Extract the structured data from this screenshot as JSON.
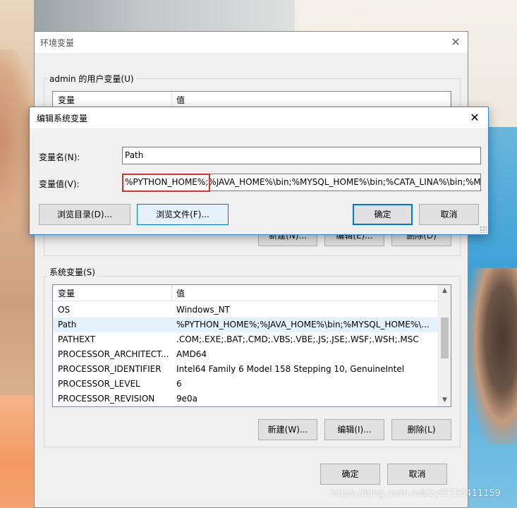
{
  "env_dialog": {
    "title": "环境变量",
    "user_group_label": "admin 的用户变量(U)",
    "user_list": {
      "col_var": "变量",
      "col_val": "值"
    },
    "user_buttons": {
      "new": "新建(N)...",
      "edit": "编辑(E)...",
      "delete": "删除(D)"
    },
    "system_group_label": "系统变量(S)",
    "system_list": {
      "col_var": "变量",
      "col_val": "值",
      "rows": [
        {
          "name": "OS",
          "value": "Windows_NT"
        },
        {
          "name": "Path",
          "value": "%PYTHON_HOME%;%JAVA_HOME%\\bin;%MYSQL_HOME%\\..."
        },
        {
          "name": "PATHEXT",
          "value": ".COM;.EXE;.BAT;.CMD;.VBS;.VBE;.JS;.JSE;.WSF;.WSH;.MSC"
        },
        {
          "name": "PROCESSOR_ARCHITECT...",
          "value": "AMD64"
        },
        {
          "name": "PROCESSOR_IDENTIFIER",
          "value": "Intel64 Family 6 Model 158 Stepping 10, GenuineIntel"
        },
        {
          "name": "PROCESSOR_LEVEL",
          "value": "6"
        },
        {
          "name": "PROCESSOR_REVISION",
          "value": "9e0a"
        }
      ]
    },
    "system_buttons": {
      "new": "新建(W)...",
      "edit": "编辑(I)...",
      "delete": "删除(L)"
    },
    "ok": "确定",
    "cancel": "取消",
    "close_symbol": "✕"
  },
  "edit_dialog": {
    "title": "编辑系统变量",
    "close_symbol": "✕",
    "name_label": "变量名(N):",
    "name_value": "Path",
    "value_label": "变量值(V):",
    "value_text": "%PYTHON_HOME%;%JAVA_HOME%\\bin;%MYSQL_HOME%\\bin;%CATA_LINA%\\bin;%M",
    "highlighted_text": "%PYTHON_HOME%;",
    "browse_dir": "浏览目录(D)...",
    "browse_file": "浏览文件(F)...",
    "ok": "确定",
    "cancel": "取消"
  },
  "watermark": "https://blog.csdn.net/zyl2726411159",
  "colors": {
    "highlight": "#e0302d",
    "selection": "#e5f1fb",
    "accent": "#0078d7"
  }
}
